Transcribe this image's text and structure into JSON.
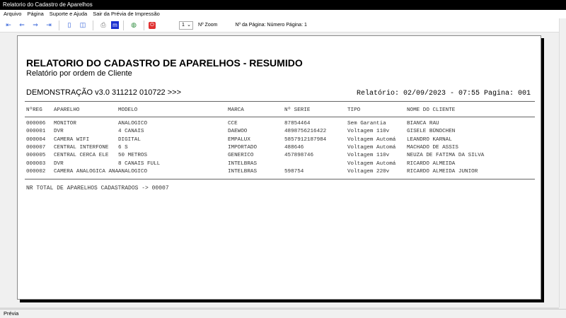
{
  "window": {
    "title": "Relatorio do Cadastro de Aparelhos"
  },
  "menu": [
    "Arquivo",
    "Página",
    "Suporte e Ajuda",
    "Sair da Prévia de Impressão"
  ],
  "toolbar": {
    "zoom_value": "1",
    "zoom_label": "Nº Zoom",
    "page_label": "Nº da Página: Número Página: 1",
    "icons": [
      "first-page-icon",
      "prev-page-icon",
      "next-page-icon",
      "last-page-icon",
      "single-page-icon",
      "two-page-icon",
      "print-icon",
      "export-icon",
      "web-icon",
      "close-icon"
    ]
  },
  "report": {
    "title": "RELATORIO DO CADASTRO DE APARELHOS - RESUMIDO",
    "subtitle": "Relatório por ordem de Cliente",
    "demo": "DEMONSTRAÇÃO v3.0 311212 010722 >>>",
    "info": "Relatório: 02/09/2023 - 07:55  Pagina: 001",
    "columns": [
      "NºREG",
      "APARELHO",
      "MODELO",
      "MARCA",
      "Nº SERIE",
      "TIPO",
      "NOME DO CLIENTE"
    ],
    "rows": [
      [
        "000006",
        "MONITOR",
        "ANALOGICO",
        "CCE",
        "87854464",
        "Sem Garantia",
        "BIANCA RAU"
      ],
      [
        "000001",
        "DVR",
        "4 CANAIS",
        "DAEWOO",
        "4898756216422",
        "Voltagem 110v",
        "GISELE BÜNDCHEN"
      ],
      [
        "000004",
        "CAMERA WIFI",
        "DIGITAL",
        "EMPALUX",
        "5857912187984",
        "Voltagem Automá",
        "LEANDRO KARNAL"
      ],
      [
        "000007",
        "CENTRAL INTERFONE",
        "6 S",
        "IMPORTADO",
        "488646",
        "Voltagem Automá",
        "MACHADO DE ASSIS"
      ],
      [
        "000005",
        "CENTRAL CERCA ELE",
        "50 METROS",
        "GENERICO",
        "457898746",
        "Voltagem 110v",
        "NEUZA DE FATIMA DA SILVA"
      ],
      [
        "000003",
        "DVR",
        "8 CANAIS FULL",
        "INTELBRAS",
        "",
        "Voltagem Automá",
        "RICARDO ALMEIDA"
      ],
      [
        "000002",
        "CAMERA ANALOGICA ANA",
        "ANALOGICO",
        "INTELBRAS",
        "598754",
        "Voltagem 220v",
        "RICARDO ALMEIDA JUNIOR"
      ]
    ],
    "total": "NR TOTAL DE APARELHOS CADASTRADOS -> 00007"
  },
  "status": "Prévia"
}
